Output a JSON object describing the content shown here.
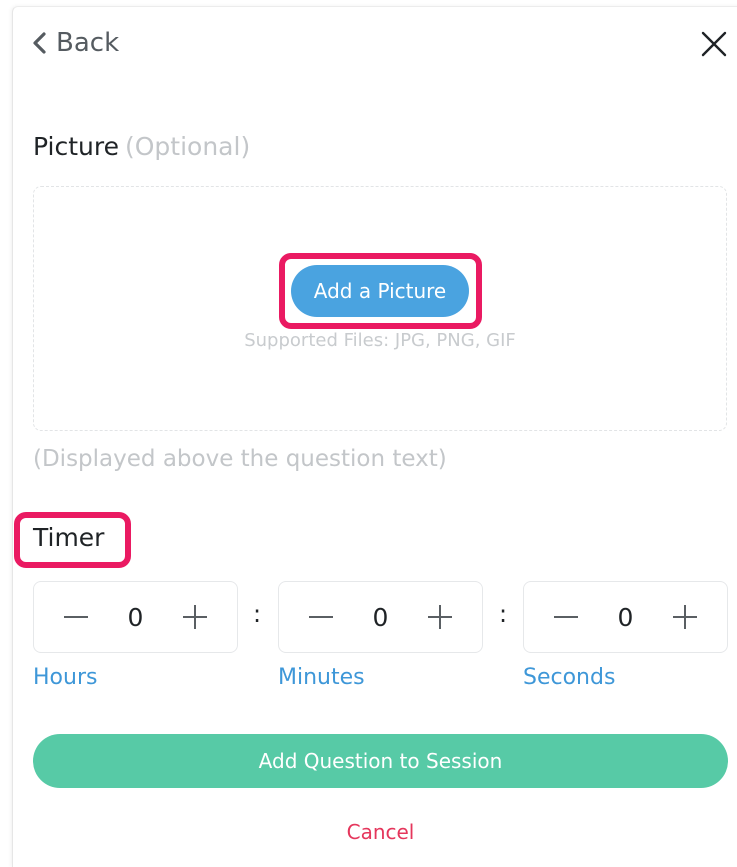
{
  "header": {
    "back_label": "Back",
    "back_icon": "chevron-left-icon",
    "close_icon": "close-icon"
  },
  "picture": {
    "title": "Picture",
    "optional_label": "(Optional)",
    "add_button_label": "Add a Picture",
    "supported_files": "Supported Files: JPG, PNG, GIF",
    "note": "(Displayed above the question text)"
  },
  "timer": {
    "title": "Timer",
    "separator": ":",
    "fields": [
      {
        "label": "Hours",
        "value": "0"
      },
      {
        "label": "Minutes",
        "value": "0"
      },
      {
        "label": "Seconds",
        "value": "0"
      }
    ]
  },
  "actions": {
    "primary_label": "Add Question to Session",
    "cancel_label": "Cancel"
  },
  "colors": {
    "highlight": "#ea1a62",
    "blue_button": "#4aa3e0",
    "green_button": "#57caa6",
    "cancel_text": "#e5365c",
    "link_blue": "#3e97d8"
  }
}
